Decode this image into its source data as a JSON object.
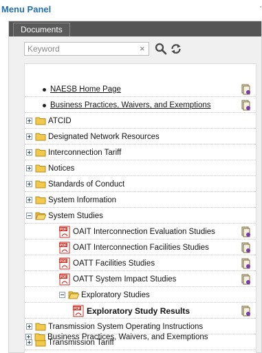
{
  "menu": {
    "title": "Menu Panel",
    "collapse_glyph": "·"
  },
  "tabs": [
    {
      "label": "Documents"
    }
  ],
  "search": {
    "placeholder": "Keyword",
    "value": "",
    "clear_glyph": "×"
  },
  "tree": {
    "links": [
      {
        "label": "NAESB Home Page"
      },
      {
        "label": "Business Practices, Waivers, and Exemptions"
      }
    ],
    "folders": [
      {
        "label": "ATCID",
        "expanded": false
      },
      {
        "label": "Designated Network Resources",
        "expanded": false
      },
      {
        "label": "Interconnection Tariff",
        "expanded": false
      },
      {
        "label": "Notices",
        "expanded": false
      },
      {
        "label": "Standards of Conduct",
        "expanded": false
      },
      {
        "label": "System Information",
        "expanded": false
      },
      {
        "label": "System Studies",
        "expanded": true
      }
    ],
    "system_studies_children": [
      {
        "label": "OAIT Interconnection Evaluation Studies"
      },
      {
        "label": "OAIT Interconnection Facilities Studies"
      },
      {
        "label": "OATT Facilities Studies"
      },
      {
        "label": "OATT System Impact Studies"
      }
    ],
    "exploratory": {
      "label": "Exploratory Studies",
      "expanded": true,
      "children": [
        {
          "label": "Exploratory Study Results"
        }
      ]
    },
    "bottom_folders": [
      {
        "label": "Transmission System Operating Instructions",
        "expanded": false
      },
      {
        "label": "Transmission Tariff",
        "expanded": false
      },
      {
        "label": "Business Practices, Waivers, and Exemptions",
        "expanded": false
      }
    ]
  },
  "icons": {
    "folder_color": "#f2c94c",
    "pdf_color": "#d62b1f",
    "accent": "#1f6fae"
  }
}
